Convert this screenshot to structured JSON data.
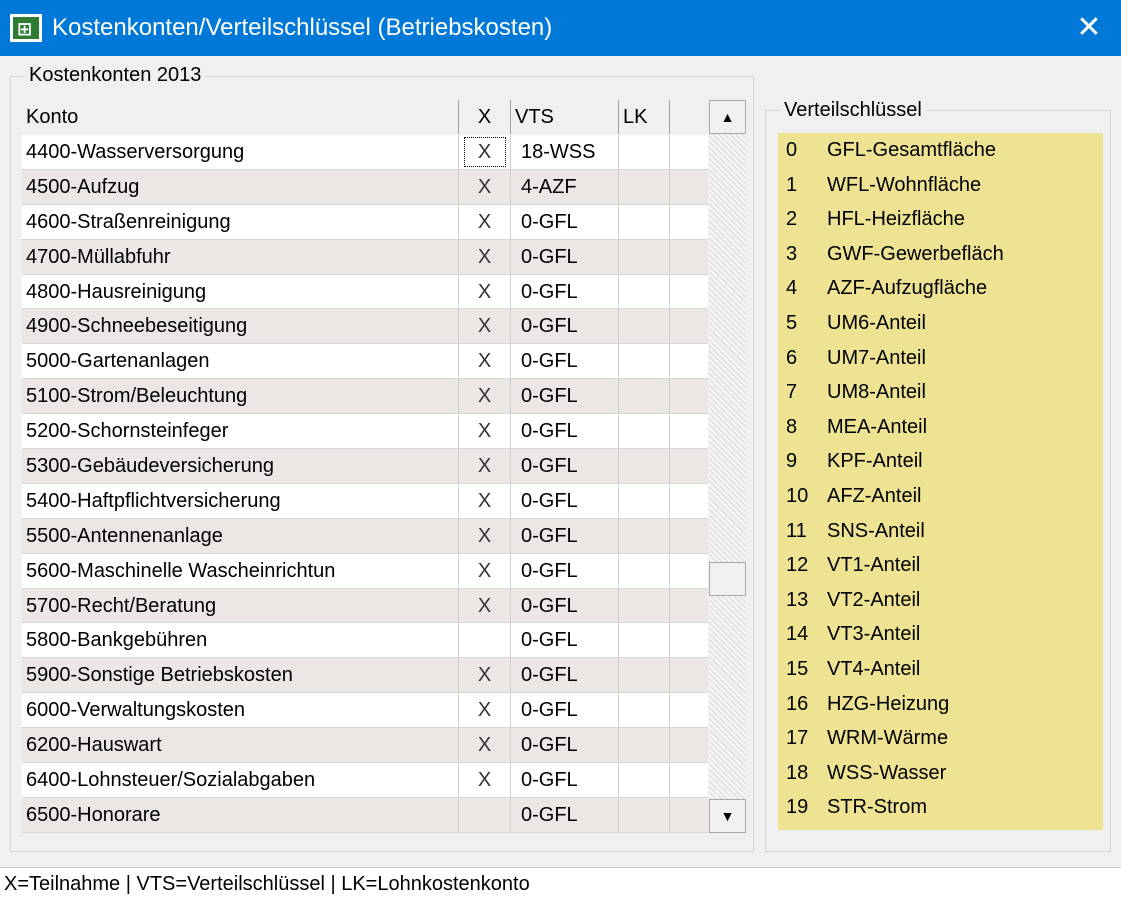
{
  "window": {
    "title": "Kostenkonten/Verteilschlüssel (Betriebskosten)",
    "close_label": "✕"
  },
  "accounts_group": {
    "label": "Kostenkonten 2013",
    "columns": {
      "konto": "Konto",
      "x": "X",
      "vts": "VTS",
      "lk": "LK"
    },
    "rows": [
      {
        "konto": "4400-Wasserversorgung",
        "x": "X",
        "vts": "18-WSS",
        "lk": "",
        "selected": true
      },
      {
        "konto": "4500-Aufzug",
        "x": "X",
        "vts": "4-AZF",
        "lk": ""
      },
      {
        "konto": "4600-Straßenreinigung",
        "x": "X",
        "vts": "0-GFL",
        "lk": ""
      },
      {
        "konto": "4700-Müllabfuhr",
        "x": "X",
        "vts": "0-GFL",
        "lk": ""
      },
      {
        "konto": "4800-Hausreinigung",
        "x": "X",
        "vts": "0-GFL",
        "lk": ""
      },
      {
        "konto": "4900-Schneebeseitigung",
        "x": "X",
        "vts": "0-GFL",
        "lk": ""
      },
      {
        "konto": "5000-Gartenanlagen",
        "x": "X",
        "vts": "0-GFL",
        "lk": ""
      },
      {
        "konto": "5100-Strom/Beleuchtung",
        "x": "X",
        "vts": "0-GFL",
        "lk": ""
      },
      {
        "konto": "5200-Schornsteinfeger",
        "x": "X",
        "vts": "0-GFL",
        "lk": ""
      },
      {
        "konto": "5300-Gebäudeversicherung",
        "x": "X",
        "vts": "0-GFL",
        "lk": ""
      },
      {
        "konto": "5400-Haftpflichtversicherung",
        "x": "X",
        "vts": "0-GFL",
        "lk": ""
      },
      {
        "konto": "5500-Antennenanlage",
        "x": "X",
        "vts": "0-GFL",
        "lk": ""
      },
      {
        "konto": "5600-Maschinelle Wascheinrichtun",
        "x": "X",
        "vts": "0-GFL",
        "lk": ""
      },
      {
        "konto": "5700-Recht/Beratung",
        "x": "X",
        "vts": "0-GFL",
        "lk": ""
      },
      {
        "konto": "5800-Bankgebühren",
        "x": "",
        "vts": "0-GFL",
        "lk": ""
      },
      {
        "konto": "5900-Sonstige Betriebskosten",
        "x": "X",
        "vts": "0-GFL",
        "lk": ""
      },
      {
        "konto": "6000-Verwaltungskosten",
        "x": "X",
        "vts": "0-GFL",
        "lk": ""
      },
      {
        "konto": "6200-Hauswart",
        "x": "X",
        "vts": "0-GFL",
        "lk": ""
      },
      {
        "konto": "6400-Lohnsteuer/Sozialabgaben",
        "x": "X",
        "vts": "0-GFL",
        "lk": ""
      },
      {
        "konto": "6500-Honorare",
        "x": "",
        "vts": "0-GFL",
        "lk": ""
      }
    ]
  },
  "scrollbar": {
    "up_glyph": "▲",
    "down_glyph": "▼"
  },
  "keys_group": {
    "label": "Verteilschlüssel",
    "items": [
      {
        "num": "0",
        "label": "GFL-Gesamtfläche"
      },
      {
        "num": "1",
        "label": "WFL-Wohnfläche"
      },
      {
        "num": "2",
        "label": "HFL-Heizfläche"
      },
      {
        "num": "3",
        "label": "GWF-Gewerbefläch"
      },
      {
        "num": "4",
        "label": "AZF-Aufzugfläche"
      },
      {
        "num": "5",
        "label": "UM6-Anteil"
      },
      {
        "num": "6",
        "label": "UM7-Anteil"
      },
      {
        "num": "7",
        "label": "UM8-Anteil"
      },
      {
        "num": "8",
        "label": "MEA-Anteil"
      },
      {
        "num": "9",
        "label": "KPF-Anteil"
      },
      {
        "num": "10",
        "label": "AFZ-Anteil"
      },
      {
        "num": "11",
        "label": "SNS-Anteil"
      },
      {
        "num": "12",
        "label": "VT1-Anteil"
      },
      {
        "num": "13",
        "label": "VT2-Anteil"
      },
      {
        "num": "14",
        "label": "VT3-Anteil"
      },
      {
        "num": "15",
        "label": "VT4-Anteil"
      },
      {
        "num": "16",
        "label": "HZG-Heizung"
      },
      {
        "num": "17",
        "label": "WRM-Wärme"
      },
      {
        "num": "18",
        "label": "WSS-Wasser"
      },
      {
        "num": "19",
        "label": "STR-Strom"
      }
    ]
  },
  "status": {
    "text": "X=Teilnahme | VTS=Verteilschlüssel | LK=Lohnkostenkonto"
  },
  "colors": {
    "titlebar": "#0078d7",
    "key_panel": "#ede393",
    "row_alt": "#ece7e4"
  }
}
